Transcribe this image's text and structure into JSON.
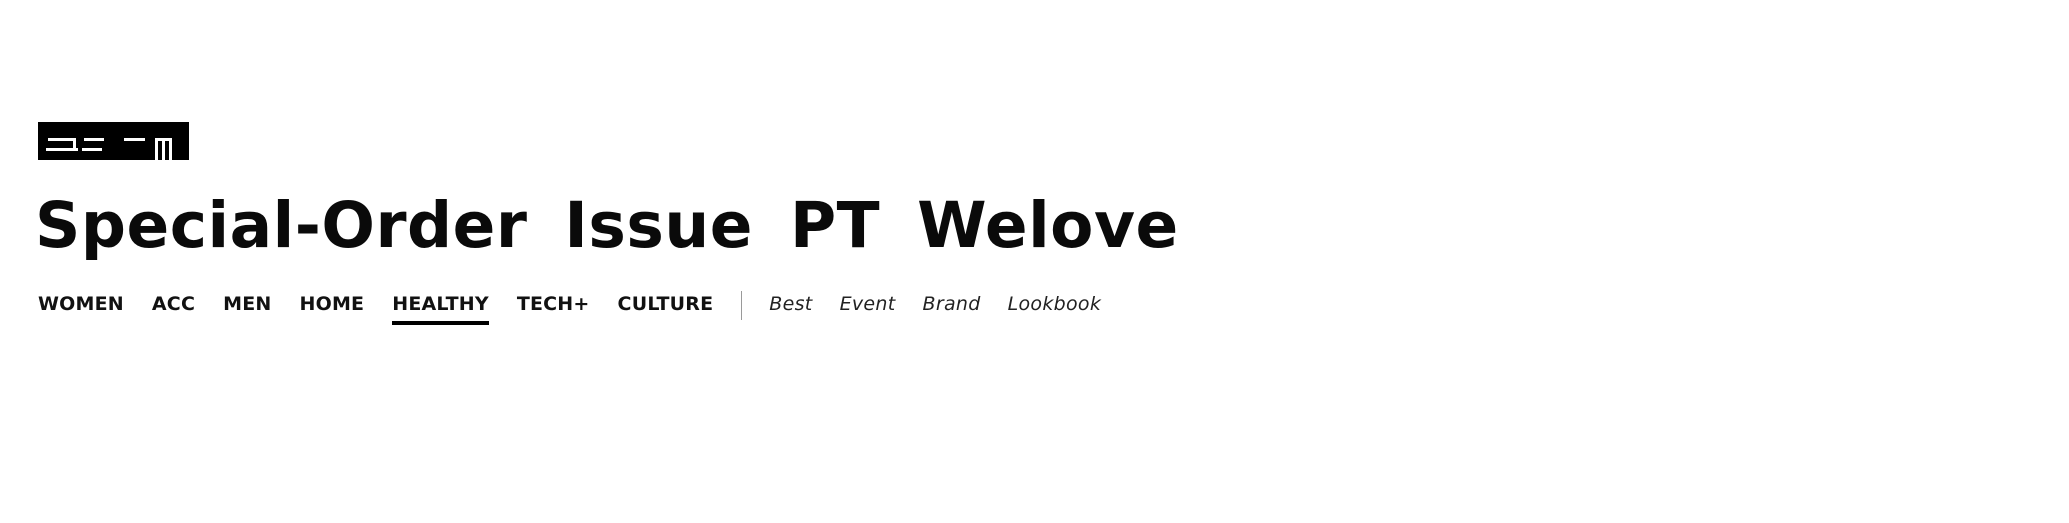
{
  "header": {
    "logo_icon": "brand-logo-icon",
    "title_words": [
      "Special-Order",
      "Issue",
      "PT",
      "Welove"
    ]
  },
  "nav": {
    "categories": [
      {
        "label": "WOMEN",
        "active": false
      },
      {
        "label": "ACC",
        "active": false
      },
      {
        "label": "MEN",
        "active": false
      },
      {
        "label": "HOME",
        "active": false
      },
      {
        "label": "HEALTHY",
        "active": true
      },
      {
        "label": "TECH+",
        "active": false
      },
      {
        "label": "CULTURE",
        "active": false
      }
    ],
    "secondary": [
      {
        "label": "Best"
      },
      {
        "label": "Event"
      },
      {
        "label": "Brand"
      },
      {
        "label": "Lookbook"
      }
    ]
  },
  "colors": {
    "text": "#000000",
    "background": "#ffffff",
    "divider": "#9a9a9a"
  }
}
